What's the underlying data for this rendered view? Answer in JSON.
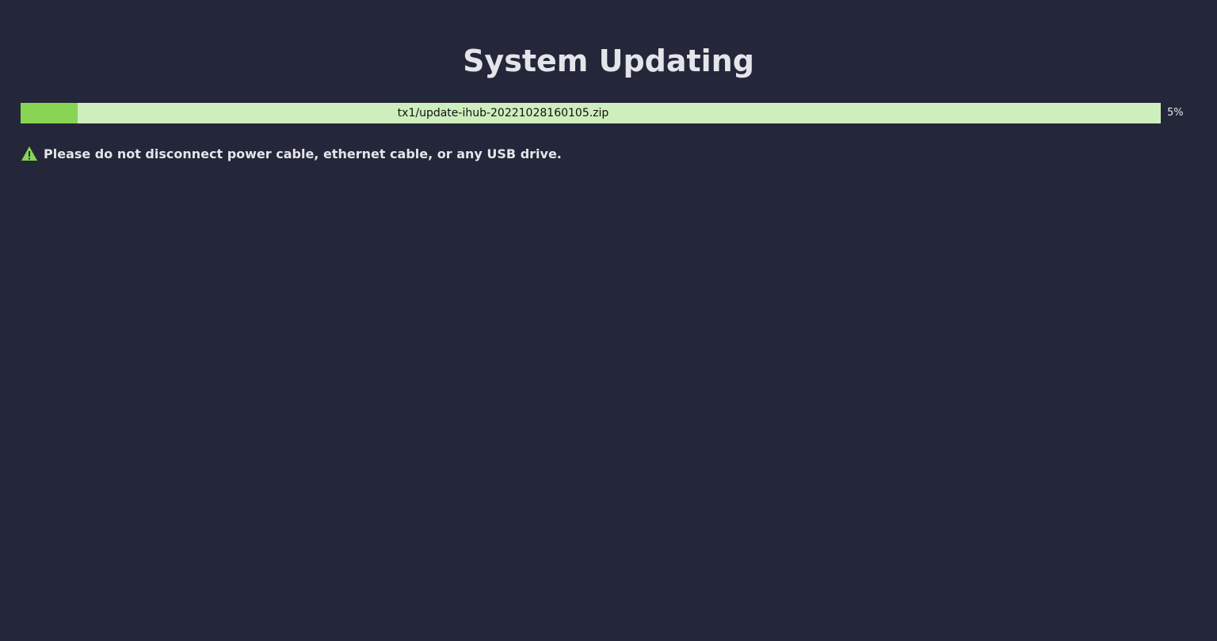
{
  "page": {
    "title": "System Updating"
  },
  "update": {
    "filename": "tx1/update-ihub-20221028160105.zip",
    "progress_percent": 5,
    "progress_label": "5%"
  },
  "warning": {
    "icon": "warning-triangle-icon",
    "text": "Please do not disconnect power cable, ethernet cable, or any USB drive."
  },
  "colors": {
    "background": "#242639",
    "progress_fill": "#87d552",
    "progress_track": "#cfeebe",
    "warning_icon": "#87d552",
    "text": "#e4e5ea"
  }
}
